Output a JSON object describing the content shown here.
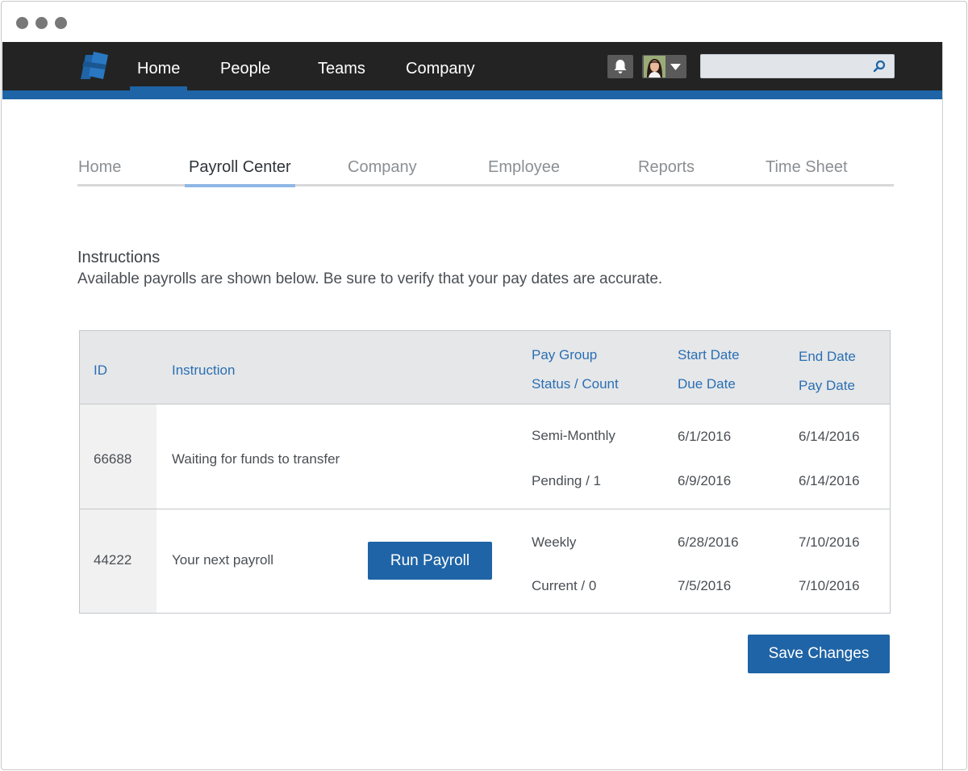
{
  "window": {
    "controls": [
      "close",
      "minimize",
      "maximize"
    ]
  },
  "topnav": {
    "logo_icon": "brand-logo-icon",
    "items": [
      {
        "label": "Home",
        "active": true
      },
      {
        "label": "People",
        "active": false
      },
      {
        "label": "Teams",
        "active": false
      },
      {
        "label": "Company",
        "active": false
      }
    ],
    "notifications_icon": "bell-icon",
    "avatar_icon": "user-avatar",
    "search": {
      "value": "",
      "placeholder": "",
      "icon": "search-icon"
    },
    "colors": {
      "bar": "#232323",
      "accent": "#1f64a6"
    }
  },
  "subnav": {
    "items": [
      {
        "label": "Home",
        "active": false
      },
      {
        "label": "Payroll Center",
        "active": true
      },
      {
        "label": "Company",
        "active": false
      },
      {
        "label": "Employee",
        "active": false
      },
      {
        "label": "Reports",
        "active": false
      },
      {
        "label": "Time Sheet",
        "active": false
      }
    ]
  },
  "instructions": {
    "title": "Instructions",
    "text": "Available payrolls are shown below. Be sure to verify that your pay dates are accurate."
  },
  "table": {
    "headers": {
      "id": "ID",
      "instruction": "Instruction",
      "pay_group": "Pay Group",
      "status_count": "Status / Count",
      "start_date": "Start Date",
      "due_date": "Due Date",
      "end_date": "End Date",
      "pay_date": "Pay Date"
    },
    "rows": [
      {
        "id": "66688",
        "instruction": "Waiting for funds to transfer",
        "pay_group": "Semi-Monthly",
        "status_count": "Pending / 1",
        "start_date": "6/1/2016",
        "due_date": "6/9/2016",
        "end_date": "6/14/2016",
        "pay_date": "6/14/2016"
      },
      {
        "id": "44222",
        "instruction": "Your next payroll",
        "action_label": "Run Payroll",
        "pay_group": "Weekly",
        "status_count": "Current / 0",
        "start_date": "6/28/2016",
        "due_date": "7/5/2016",
        "end_date": "7/10/2016",
        "pay_date": "7/10/2016"
      }
    ]
  },
  "footer": {
    "save_label": "Save Changes"
  }
}
